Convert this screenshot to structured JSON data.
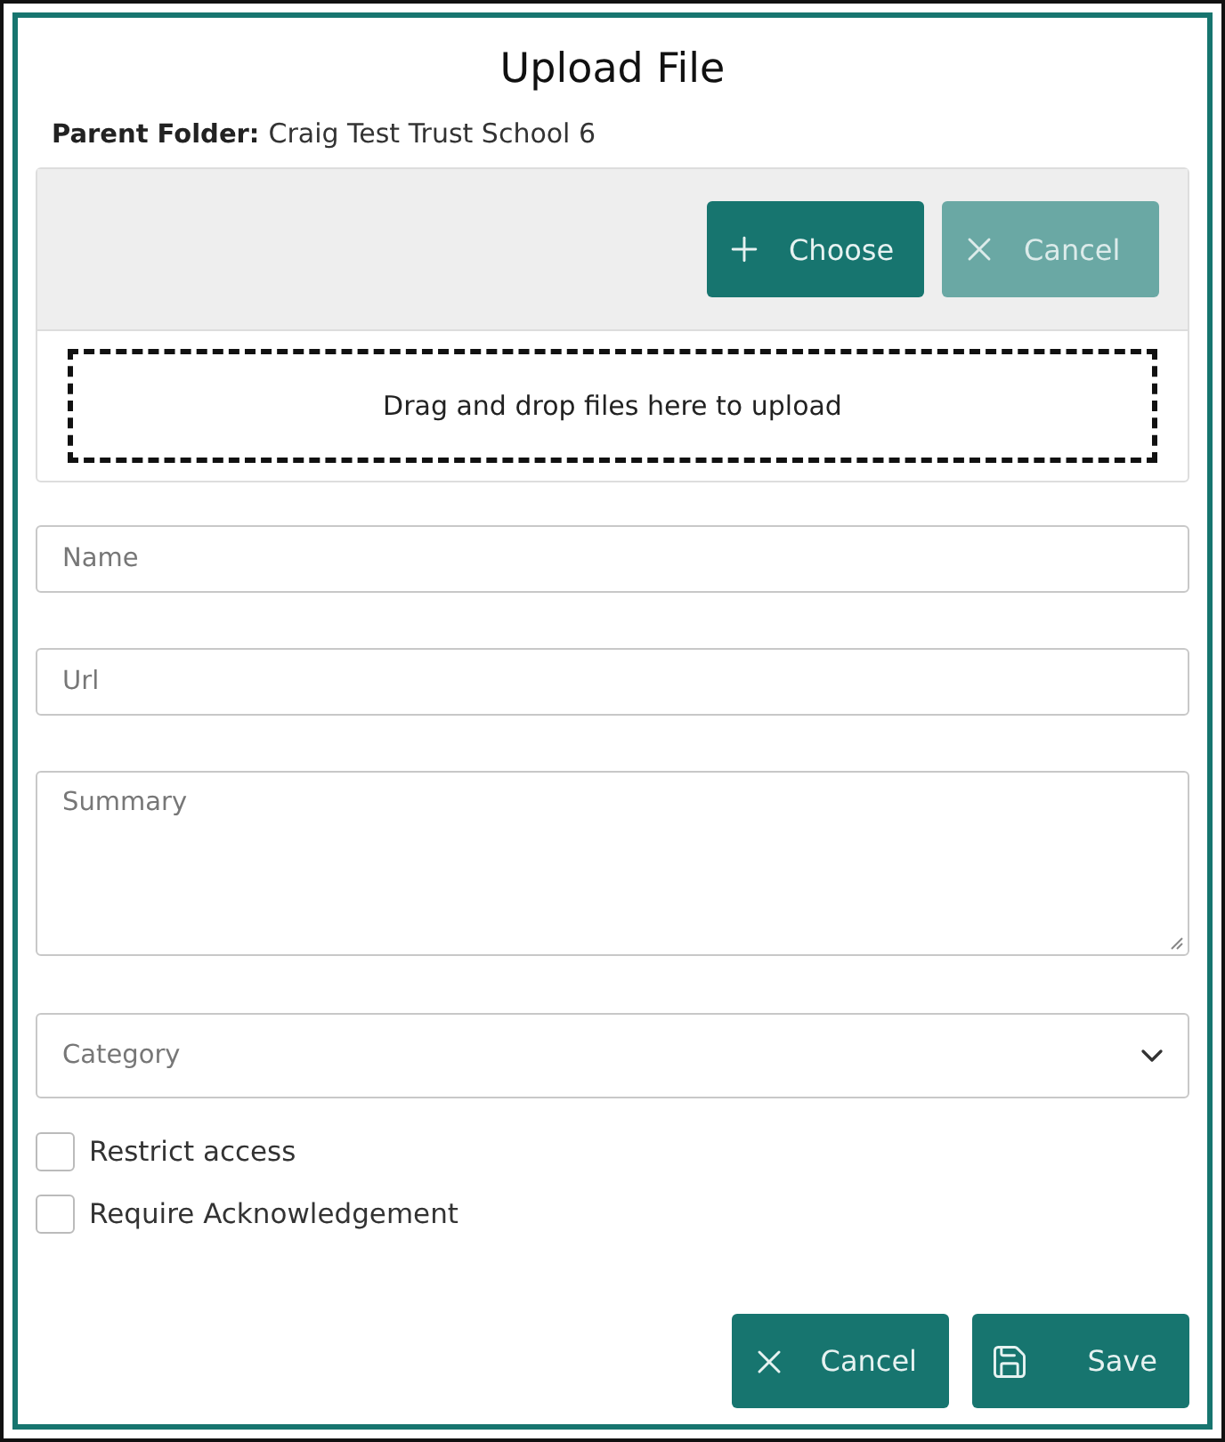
{
  "dialog": {
    "title": "Upload File"
  },
  "parent_folder": {
    "label": "Parent Folder:",
    "value": "Craig Test Trust School 6"
  },
  "uploader": {
    "buttons": [
      {
        "label": "Choose",
        "kind": "choose",
        "disabled": false
      },
      {
        "label": "Cancel",
        "kind": "cancel",
        "disabled": true
      }
    ],
    "dropzone_text": "Drag and drop files here to upload"
  },
  "fields": [
    {
      "kind": "input",
      "placeholder": "Name"
    },
    {
      "kind": "input",
      "placeholder": "Url"
    },
    {
      "kind": "textarea",
      "placeholder": "Summary"
    },
    {
      "kind": "select",
      "placeholder": "Category"
    }
  ],
  "checkboxes": [
    {
      "label": "Restrict access",
      "checked": false
    },
    {
      "label": "Require Acknowledgement",
      "checked": false
    }
  ],
  "footer_buttons": [
    {
      "label": "Cancel",
      "kind": "cancel"
    },
    {
      "label": "Save",
      "kind": "save"
    }
  ]
}
